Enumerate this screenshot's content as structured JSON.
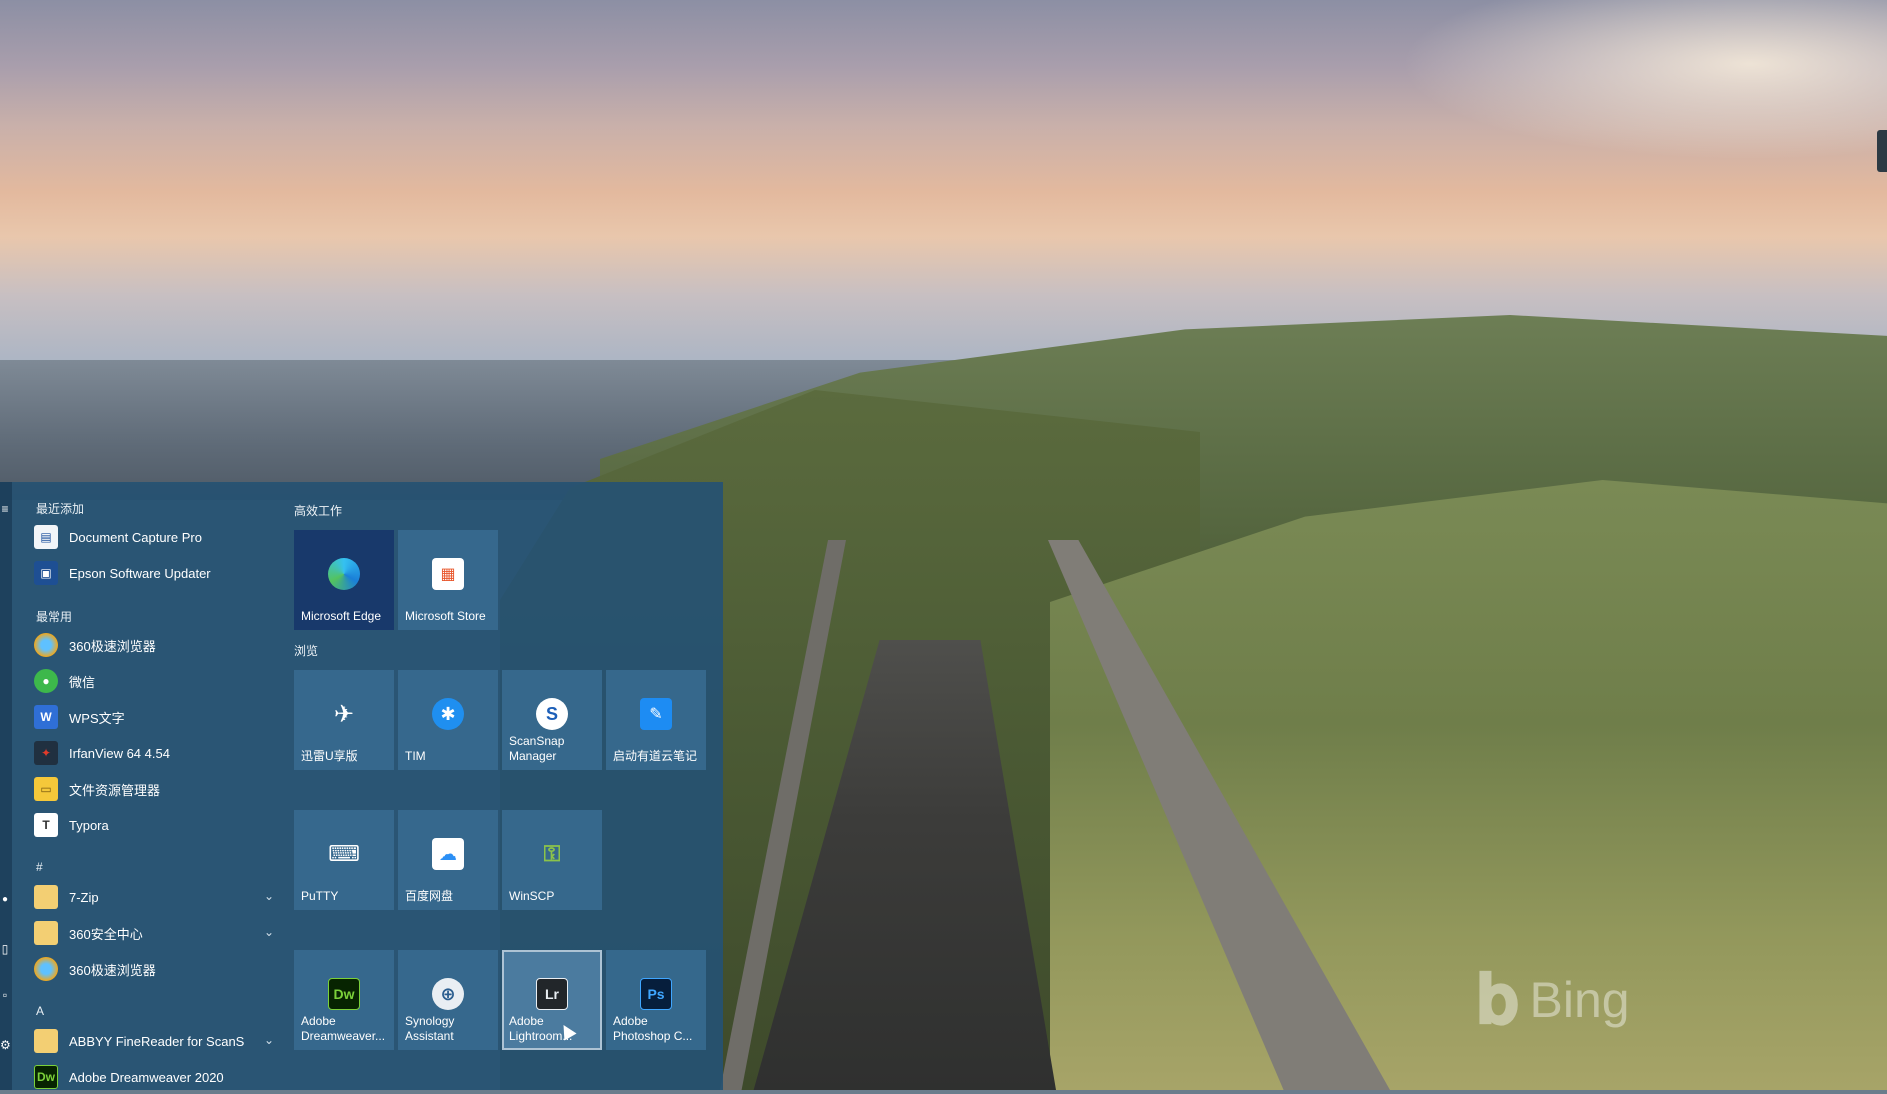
{
  "wallpaper": {
    "watermark": "Bing"
  },
  "start_menu": {
    "sections": {
      "recent": "最近添加",
      "most_used": "最常用",
      "hash": "#",
      "a": "A"
    },
    "recent_apps": [
      {
        "label": "Document Capture Pro",
        "icon": "document-capture-icon"
      },
      {
        "label": "Epson Software Updater",
        "icon": "epson-updater-icon"
      }
    ],
    "most_used_apps": [
      {
        "label": "360极速浏览器",
        "icon": "360-browser-icon"
      },
      {
        "label": "微信",
        "icon": "wechat-icon"
      },
      {
        "label": "WPS文字",
        "icon": "wps-icon"
      },
      {
        "label": "IrfanView 64 4.54",
        "icon": "irfanview-icon"
      },
      {
        "label": "文件资源管理器",
        "icon": "file-explorer-icon"
      },
      {
        "label": "Typora",
        "icon": "typora-icon"
      }
    ],
    "hash_apps": [
      {
        "label": "7-Zip",
        "icon": "folder-icon",
        "expandable": true
      },
      {
        "label": "360安全中心",
        "icon": "folder-icon",
        "expandable": true
      },
      {
        "label": "360极速浏览器",
        "icon": "360-browser-icon",
        "expandable": false
      }
    ],
    "a_apps": [
      {
        "label": "ABBYY FineReader for ScanSn...",
        "icon": "folder-icon",
        "expandable": true
      },
      {
        "label": "Adobe Dreamweaver 2020",
        "icon": "dreamweaver-icon",
        "expandable": false
      }
    ],
    "tile_groups": [
      {
        "title": "高效工作"
      },
      {
        "title": "浏览"
      }
    ],
    "tiles": {
      "edge": "Microsoft Edge",
      "store": "Microsoft Store",
      "xunlei": "迅雷U享版",
      "tim": "TIM",
      "scansnap": "ScanSnap Manager",
      "youdao": "启动有道云笔记",
      "putty": "PuTTY",
      "baidu": "百度网盘",
      "winscp": "WinSCP",
      "dreamweaver": "Adobe Dreamweaver...",
      "synology": "Synology Assistant",
      "lightroom": "Adobe Lightroom...",
      "photoshop": "Adobe Photoshop C..."
    },
    "icon_glyphs": {
      "dw": "Dw",
      "lr": "Lr",
      "ps": "Ps",
      "t": "T",
      "w": "W"
    }
  }
}
